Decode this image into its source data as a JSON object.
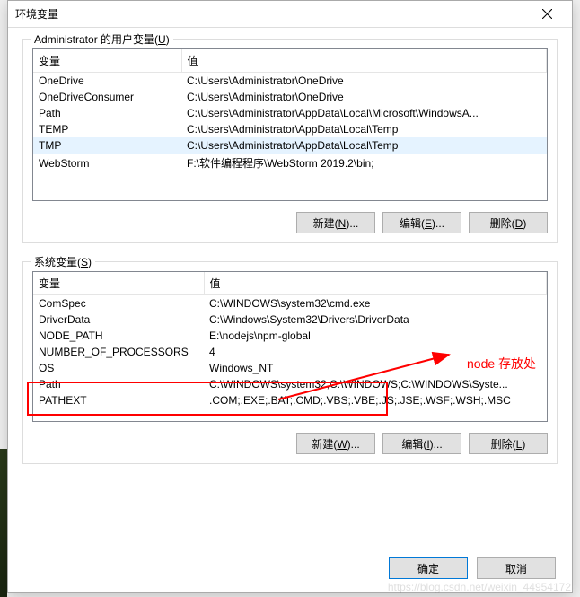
{
  "window": {
    "title": "环境变量",
    "close_label": "关闭"
  },
  "user_section": {
    "legend_prefix": "Administrator 的用户变量(",
    "legend_hotkey": "U",
    "legend_suffix": ")",
    "headers": {
      "var": "变量",
      "val": "值"
    },
    "rows": [
      {
        "name": "OneDrive",
        "value": "C:\\Users\\Administrator\\OneDrive"
      },
      {
        "name": "OneDriveConsumer",
        "value": "C:\\Users\\Administrator\\OneDrive"
      },
      {
        "name": "Path",
        "value": "C:\\Users\\Administrator\\AppData\\Local\\Microsoft\\WindowsA..."
      },
      {
        "name": "TEMP",
        "value": "C:\\Users\\Administrator\\AppData\\Local\\Temp"
      },
      {
        "name": "TMP",
        "value": "C:\\Users\\Administrator\\AppData\\Local\\Temp",
        "selected": true
      },
      {
        "name": "WebStorm",
        "value": "F:\\软件编程程序\\WebStorm 2019.2\\bin;"
      }
    ],
    "buttons": {
      "new": {
        "text": "新建(",
        "hk": "N",
        "suffix": ")..."
      },
      "edit": {
        "text": "编辑(",
        "hk": "E",
        "suffix": ")..."
      },
      "del": {
        "text": "删除(",
        "hk": "D",
        "suffix": ")"
      }
    }
  },
  "system_section": {
    "legend_prefix": "系统变量(",
    "legend_hotkey": "S",
    "legend_suffix": ")",
    "headers": {
      "var": "变量",
      "val": "值"
    },
    "rows": [
      {
        "name": "ComSpec",
        "value": "C:\\WINDOWS\\system32\\cmd.exe"
      },
      {
        "name": "DriverData",
        "value": "C:\\Windows\\System32\\Drivers\\DriverData"
      },
      {
        "name": "NODE_PATH",
        "value": "E:\\nodejs\\npm-global"
      },
      {
        "name": "NUMBER_OF_PROCESSORS",
        "value": "4"
      },
      {
        "name": "OS",
        "value": "Windows_NT"
      },
      {
        "name": "Path",
        "value": "C:\\WINDOWS\\system32;C:\\WINDOWS;C:\\WINDOWS\\Syste..."
      },
      {
        "name": "PATHEXT",
        "value": ".COM;.EXE;.BAT;.CMD;.VBS;.VBE;.JS;.JSE;.WSF;.WSH;.MSC"
      }
    ],
    "buttons": {
      "new": {
        "text": "新建(",
        "hk": "W",
        "suffix": ")..."
      },
      "edit": {
        "text": "编辑(",
        "hk": "I",
        "suffix": ")..."
      },
      "del": {
        "text": "删除(",
        "hk": "L",
        "suffix": ")"
      }
    }
  },
  "dialog_buttons": {
    "ok": "确定",
    "cancel": "取消"
  },
  "annotation": {
    "text": "node 存放处"
  },
  "watermark": "https://blog.csdn.net/weixin_44954172"
}
